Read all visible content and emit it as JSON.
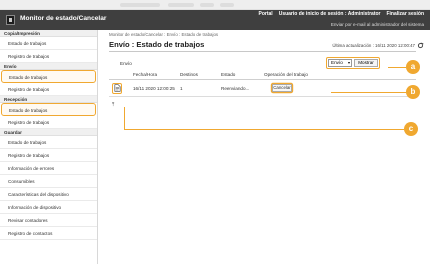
{
  "header": {
    "title": "Monitor de estado/Cancelar",
    "nav": [
      "Portal",
      "Usuario de inicio de sesión : Administrator",
      "Finalizar sesión"
    ],
    "email_link": "Enviar por e-mail al administrador del sistema"
  },
  "sidebar": {
    "sections": [
      {
        "label": "Copia/Impresión",
        "items": [
          "Estado de trabajos",
          "Registro de trabajos"
        ]
      },
      {
        "label": "Envío",
        "items": [
          "Estado de trabajos",
          "Registro de trabajos"
        ]
      },
      {
        "label": "Recepción",
        "items": [
          "Estado de trabajos",
          "Registro de trabajos"
        ]
      },
      {
        "label": "Guardar",
        "items": [
          "Estado de trabajos",
          "Registro de trabajos",
          "Información de errores",
          "Consumibles",
          "Características del dispositivo",
          "Información de dispositivo",
          "Revisar contadores",
          "Registro de contactos"
        ]
      }
    ]
  },
  "main": {
    "breadcrumb": "Monitor de estado/Cancelar : Envío : Estado de trabajos",
    "page_title": "Envío : Estado de trabajos",
    "last_update": "Última actualización : 16/11 2020 12:00:47",
    "filter_label": "Envío",
    "filter_selected": "Envío",
    "show_button": "Mostrar",
    "columns": [
      "Fecha/Hora",
      "Destinos",
      "Estado",
      "Operación del trabajo"
    ],
    "rows": [
      {
        "datetime": "16/11 2020 12:00:25",
        "destinations": "1",
        "status": "Reenviando...",
        "action": "Cancelar"
      }
    ]
  },
  "callouts": [
    "a",
    "b",
    "c"
  ],
  "colors": {
    "accent": "#f0a830",
    "header_bg": "#3f3f3f"
  }
}
